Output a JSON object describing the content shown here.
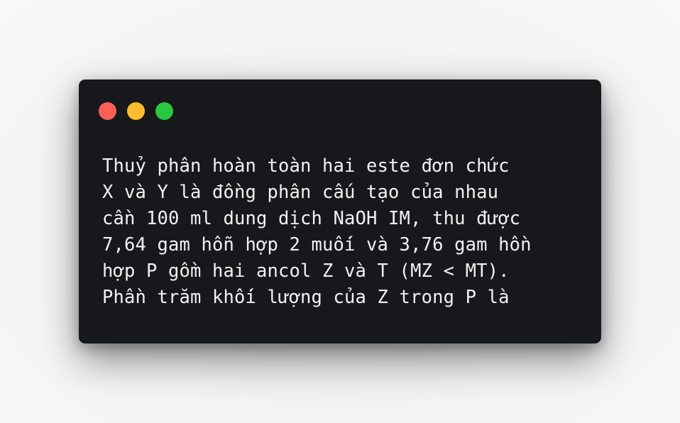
{
  "window": {
    "controls": {
      "close_color": "#ff5f57",
      "minimize_color": "#febc2e",
      "zoom_color": "#28c840"
    },
    "background_color": "#17181b"
  },
  "code": {
    "lines": [
      "Thuỷ phân hoàn toàn hai este đơn chức",
      "X và Y là đồng phân cấu tạo của nhau",
      "cần 100 ml dung dịch NaOH IM, thu được",
      "7,64 gam hỗn hợp 2 muối và 3,76 gam hồn",
      "hợp P gồm hai ancol Z và T (MZ < MT).",
      "Phần trăm khối lượng của Z trong P là"
    ]
  }
}
